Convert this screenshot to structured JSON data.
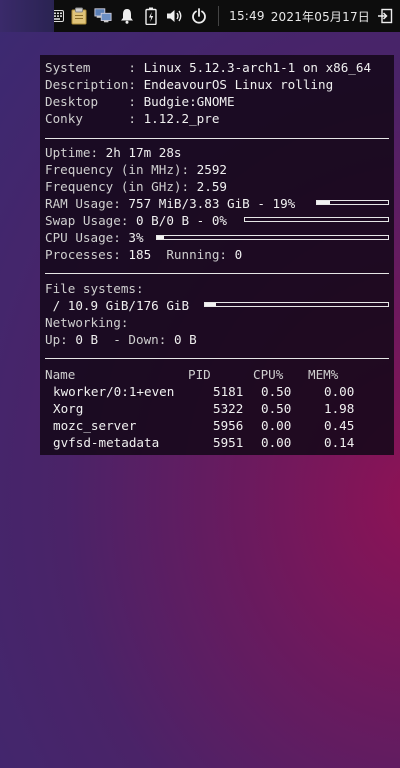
{
  "taskbar": {
    "time": "15:49",
    "date": "2021年05月17日",
    "icons": [
      "keyboard-icon",
      "clipboard-icon",
      "network-icon",
      "notification-bell-icon",
      "battery-icon",
      "volume-icon",
      "power-icon",
      "logout-icon"
    ]
  },
  "conky": {
    "system": [
      {
        "label": "System     :",
        "value": "Linux 5.12.3-arch1-1 on x86_64"
      },
      {
        "label": "Description:",
        "value": "EndeavourOS Linux rolling"
      },
      {
        "label": "Desktop    :",
        "value": "Budgie:GNOME"
      },
      {
        "label": "Conky      :",
        "value": "1.12.2_pre"
      }
    ],
    "uptime_label": "Uptime:",
    "uptime": "2h 17m 28s",
    "freq_mhz_label": "Frequency (in MHz):",
    "freq_mhz": "2592",
    "freq_ghz_label": "Frequency (in GHz):",
    "freq_ghz": "2.59",
    "ram_label": "RAM Usage:",
    "ram": "757 MiB/3.83 GiB - 19%",
    "ram_pct": 19,
    "swap_label": "Swap Usage:",
    "swap": "0 B/0 B - 0%",
    "swap_pct": 0,
    "cpu_label": "CPU Usage:",
    "cpu": "3%",
    "cpu_pct": 3,
    "processes_label": "Processes:",
    "processes": "185",
    "running_label": "Running:",
    "running": "0",
    "fs_label": "File systems:",
    "fs_line": " / 10.9 GiB/176 GiB",
    "fs_pct": 6,
    "net_label": "Networking:",
    "up_label": "Up:",
    "up": "0 B",
    "down_label": "- Down:",
    "down": "0 B",
    "proc_headers": [
      "Name",
      "PID",
      "CPU%",
      "MEM%"
    ],
    "procs": [
      {
        "name": "kworker/0:1+even",
        "pid": "5181",
        "cpu": "0.50",
        "mem": "0.00"
      },
      {
        "name": "Xorg",
        "pid": "5322",
        "cpu": "0.50",
        "mem": "1.98"
      },
      {
        "name": "mozc_server",
        "pid": "5956",
        "cpu": "0.00",
        "mem": "0.45"
      },
      {
        "name": "gvfsd-metadata",
        "pid": "5951",
        "cpu": "0.00",
        "mem": "0.14"
      }
    ]
  }
}
